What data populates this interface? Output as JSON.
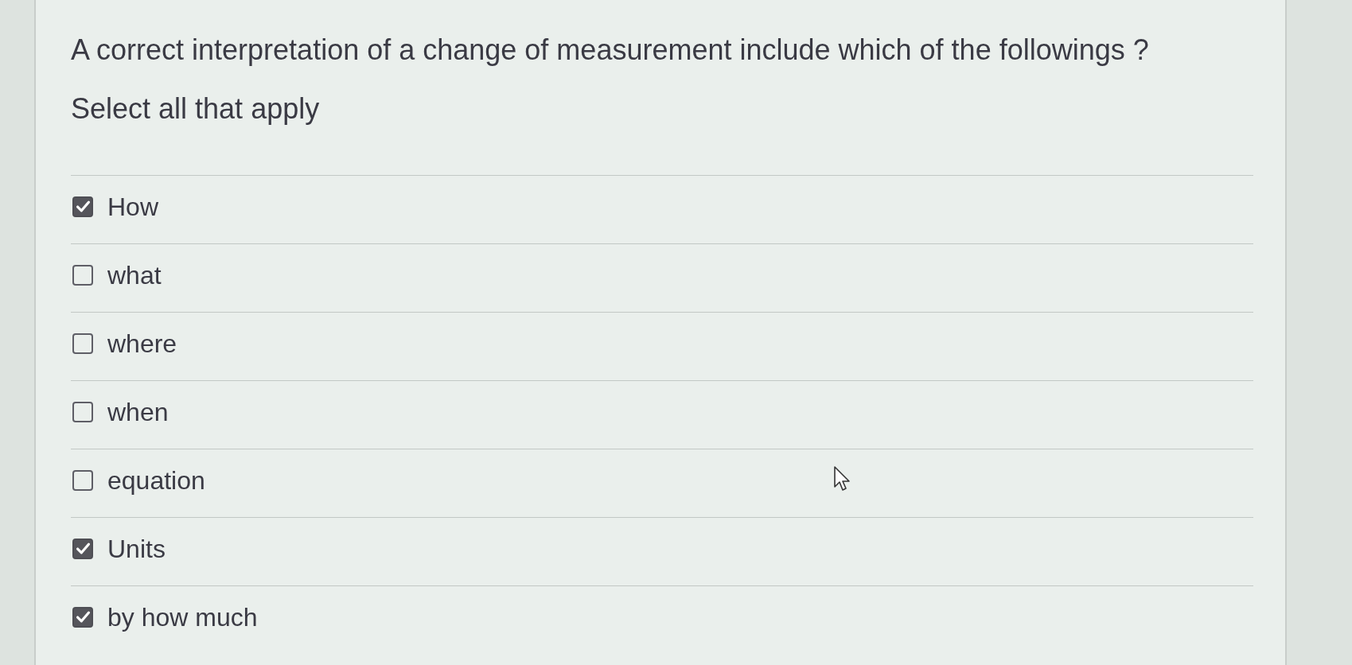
{
  "question": {
    "text": "A correct interpretation of a change of measurement include which of the followings ?",
    "instruction": "Select all that apply"
  },
  "options": [
    {
      "label": "How",
      "checked": true
    },
    {
      "label": "what",
      "checked": false
    },
    {
      "label": "where",
      "checked": false
    },
    {
      "label": "when",
      "checked": false
    },
    {
      "label": "equation",
      "checked": false
    },
    {
      "label": "Units",
      "checked": true
    },
    {
      "label": "by how much",
      "checked": true
    }
  ]
}
